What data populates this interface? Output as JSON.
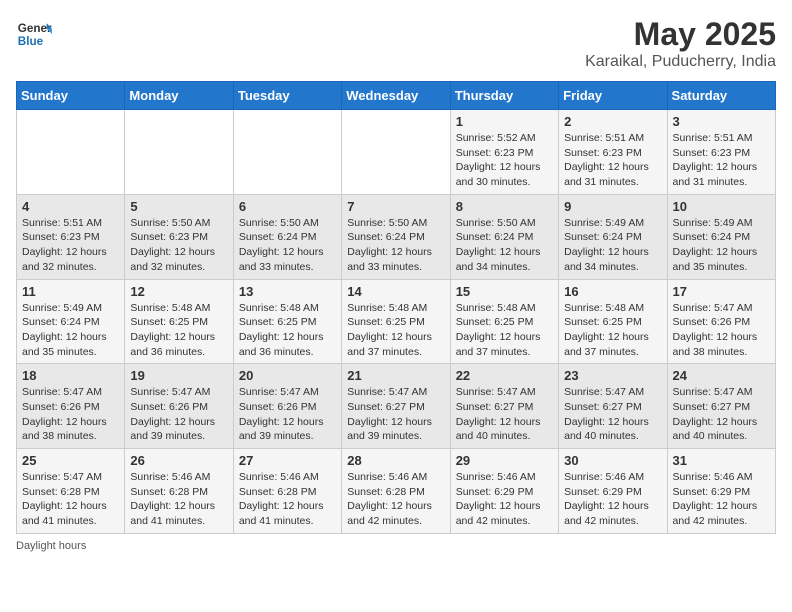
{
  "header": {
    "logo_general": "General",
    "logo_blue": "Blue",
    "title": "May 2025",
    "location": "Karaikal, Puducherry, India"
  },
  "calendar": {
    "days_of_week": [
      "Sunday",
      "Monday",
      "Tuesday",
      "Wednesday",
      "Thursday",
      "Friday",
      "Saturday"
    ],
    "weeks": [
      [
        {
          "day": "",
          "info": ""
        },
        {
          "day": "",
          "info": ""
        },
        {
          "day": "",
          "info": ""
        },
        {
          "day": "",
          "info": ""
        },
        {
          "day": "1",
          "info": "Sunrise: 5:52 AM\nSunset: 6:23 PM\nDaylight: 12 hours and 30 minutes."
        },
        {
          "day": "2",
          "info": "Sunrise: 5:51 AM\nSunset: 6:23 PM\nDaylight: 12 hours and 31 minutes."
        },
        {
          "day": "3",
          "info": "Sunrise: 5:51 AM\nSunset: 6:23 PM\nDaylight: 12 hours and 31 minutes."
        }
      ],
      [
        {
          "day": "4",
          "info": "Sunrise: 5:51 AM\nSunset: 6:23 PM\nDaylight: 12 hours and 32 minutes."
        },
        {
          "day": "5",
          "info": "Sunrise: 5:50 AM\nSunset: 6:23 PM\nDaylight: 12 hours and 32 minutes."
        },
        {
          "day": "6",
          "info": "Sunrise: 5:50 AM\nSunset: 6:24 PM\nDaylight: 12 hours and 33 minutes."
        },
        {
          "day": "7",
          "info": "Sunrise: 5:50 AM\nSunset: 6:24 PM\nDaylight: 12 hours and 33 minutes."
        },
        {
          "day": "8",
          "info": "Sunrise: 5:50 AM\nSunset: 6:24 PM\nDaylight: 12 hours and 34 minutes."
        },
        {
          "day": "9",
          "info": "Sunrise: 5:49 AM\nSunset: 6:24 PM\nDaylight: 12 hours and 34 minutes."
        },
        {
          "day": "10",
          "info": "Sunrise: 5:49 AM\nSunset: 6:24 PM\nDaylight: 12 hours and 35 minutes."
        }
      ],
      [
        {
          "day": "11",
          "info": "Sunrise: 5:49 AM\nSunset: 6:24 PM\nDaylight: 12 hours and 35 minutes."
        },
        {
          "day": "12",
          "info": "Sunrise: 5:48 AM\nSunset: 6:25 PM\nDaylight: 12 hours and 36 minutes."
        },
        {
          "day": "13",
          "info": "Sunrise: 5:48 AM\nSunset: 6:25 PM\nDaylight: 12 hours and 36 minutes."
        },
        {
          "day": "14",
          "info": "Sunrise: 5:48 AM\nSunset: 6:25 PM\nDaylight: 12 hours and 37 minutes."
        },
        {
          "day": "15",
          "info": "Sunrise: 5:48 AM\nSunset: 6:25 PM\nDaylight: 12 hours and 37 minutes."
        },
        {
          "day": "16",
          "info": "Sunrise: 5:48 AM\nSunset: 6:25 PM\nDaylight: 12 hours and 37 minutes."
        },
        {
          "day": "17",
          "info": "Sunrise: 5:47 AM\nSunset: 6:26 PM\nDaylight: 12 hours and 38 minutes."
        }
      ],
      [
        {
          "day": "18",
          "info": "Sunrise: 5:47 AM\nSunset: 6:26 PM\nDaylight: 12 hours and 38 minutes."
        },
        {
          "day": "19",
          "info": "Sunrise: 5:47 AM\nSunset: 6:26 PM\nDaylight: 12 hours and 39 minutes."
        },
        {
          "day": "20",
          "info": "Sunrise: 5:47 AM\nSunset: 6:26 PM\nDaylight: 12 hours and 39 minutes."
        },
        {
          "day": "21",
          "info": "Sunrise: 5:47 AM\nSunset: 6:27 PM\nDaylight: 12 hours and 39 minutes."
        },
        {
          "day": "22",
          "info": "Sunrise: 5:47 AM\nSunset: 6:27 PM\nDaylight: 12 hours and 40 minutes."
        },
        {
          "day": "23",
          "info": "Sunrise: 5:47 AM\nSunset: 6:27 PM\nDaylight: 12 hours and 40 minutes."
        },
        {
          "day": "24",
          "info": "Sunrise: 5:47 AM\nSunset: 6:27 PM\nDaylight: 12 hours and 40 minutes."
        }
      ],
      [
        {
          "day": "25",
          "info": "Sunrise: 5:47 AM\nSunset: 6:28 PM\nDaylight: 12 hours and 41 minutes."
        },
        {
          "day": "26",
          "info": "Sunrise: 5:46 AM\nSunset: 6:28 PM\nDaylight: 12 hours and 41 minutes."
        },
        {
          "day": "27",
          "info": "Sunrise: 5:46 AM\nSunset: 6:28 PM\nDaylight: 12 hours and 41 minutes."
        },
        {
          "day": "28",
          "info": "Sunrise: 5:46 AM\nSunset: 6:28 PM\nDaylight: 12 hours and 42 minutes."
        },
        {
          "day": "29",
          "info": "Sunrise: 5:46 AM\nSunset: 6:29 PM\nDaylight: 12 hours and 42 minutes."
        },
        {
          "day": "30",
          "info": "Sunrise: 5:46 AM\nSunset: 6:29 PM\nDaylight: 12 hours and 42 minutes."
        },
        {
          "day": "31",
          "info": "Sunrise: 5:46 AM\nSunset: 6:29 PM\nDaylight: 12 hours and 42 minutes."
        }
      ]
    ]
  },
  "footer": {
    "note": "Daylight hours"
  }
}
